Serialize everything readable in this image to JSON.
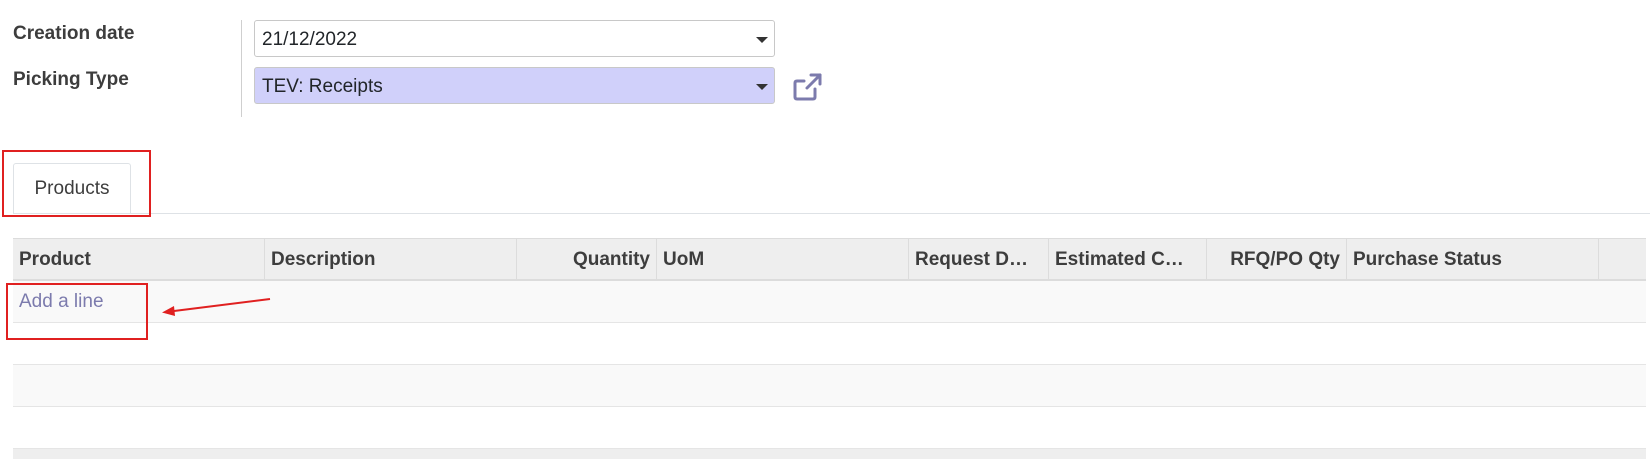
{
  "form": {
    "creation_date_label": "Creation date",
    "creation_date_value": "21/12/2022",
    "picking_type_label": "Picking Type",
    "picking_type_value": "TEV: Receipts"
  },
  "tabs": [
    {
      "label": "Products",
      "active": true
    }
  ],
  "table": {
    "columns": [
      "Product",
      "Description",
      "Quantity",
      "UoM",
      "Request D…",
      "Estimated C…",
      "RFQ/PO Qty",
      "Purchase Status"
    ],
    "add_line_label": "Add a line"
  },
  "colors": {
    "accent": "#7c7bad",
    "highlight_field": "#d0d0fa",
    "annotation": "#e02020"
  },
  "icons": {
    "external_link": "external-link-icon",
    "dropdown": "caret-down-icon"
  }
}
